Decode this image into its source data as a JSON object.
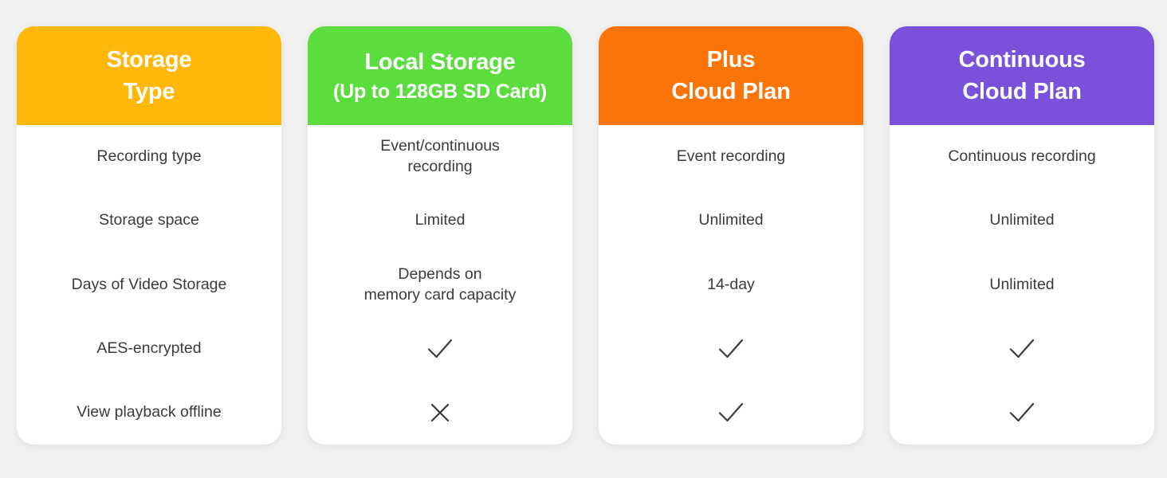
{
  "page": {
    "background_color": "#f1f1f1",
    "text_color": "#3b3b3b"
  },
  "columns": [
    {
      "id": "storage-type",
      "header": {
        "title": "Storage",
        "subtitle": "Type",
        "subtitle_small": false,
        "background_color": "#FFB80A",
        "text_color": "#ffffff"
      },
      "cells": [
        {
          "type": "text",
          "lines": [
            "Recording type"
          ]
        },
        {
          "type": "text",
          "lines": [
            "Storage space"
          ]
        },
        {
          "type": "text",
          "lines": [
            "Days of Video Storage"
          ]
        },
        {
          "type": "text",
          "lines": [
            "AES-encrypted"
          ]
        },
        {
          "type": "text",
          "lines": [
            "View playback offline"
          ]
        }
      ]
    },
    {
      "id": "local-storage",
      "header": {
        "title": "Local Storage",
        "subtitle": "(Up to 128GB SD Card)",
        "subtitle_small": true,
        "background_color": "#5CDD3E",
        "text_color": "#ffffff"
      },
      "cells": [
        {
          "type": "text",
          "lines": [
            "Event/continuous",
            "recording"
          ]
        },
        {
          "type": "text",
          "lines": [
            "Limited"
          ]
        },
        {
          "type": "text",
          "lines": [
            "Depends on",
            "memory card capacity"
          ]
        },
        {
          "type": "mark",
          "mark": "check",
          "label": "yes"
        },
        {
          "type": "mark",
          "mark": "cross",
          "label": "no"
        }
      ]
    },
    {
      "id": "plus-cloud-plan",
      "header": {
        "title": "Plus",
        "subtitle": "Cloud Plan",
        "subtitle_small": false,
        "background_color": "#FA7408",
        "text_color": "#ffffff"
      },
      "cells": [
        {
          "type": "text",
          "lines": [
            "Event recording"
          ]
        },
        {
          "type": "text",
          "lines": [
            "Unlimited"
          ]
        },
        {
          "type": "text",
          "lines": [
            "14-day"
          ]
        },
        {
          "type": "mark",
          "mark": "check",
          "label": "yes"
        },
        {
          "type": "mark",
          "mark": "check",
          "label": "yes"
        }
      ]
    },
    {
      "id": "continuous-cloud-plan",
      "header": {
        "title": "Continuous",
        "subtitle": "Cloud Plan",
        "subtitle_small": false,
        "background_color": "#7B51DC",
        "text_color": "#ffffff"
      },
      "cells": [
        {
          "type": "text",
          "lines": [
            "Continuous recording"
          ]
        },
        {
          "type": "text",
          "lines": [
            "Unlimited"
          ]
        },
        {
          "type": "text",
          "lines": [
            "Unlimited"
          ]
        },
        {
          "type": "mark",
          "mark": "check",
          "label": "yes"
        },
        {
          "type": "mark",
          "mark": "check",
          "label": "yes"
        }
      ]
    }
  ]
}
